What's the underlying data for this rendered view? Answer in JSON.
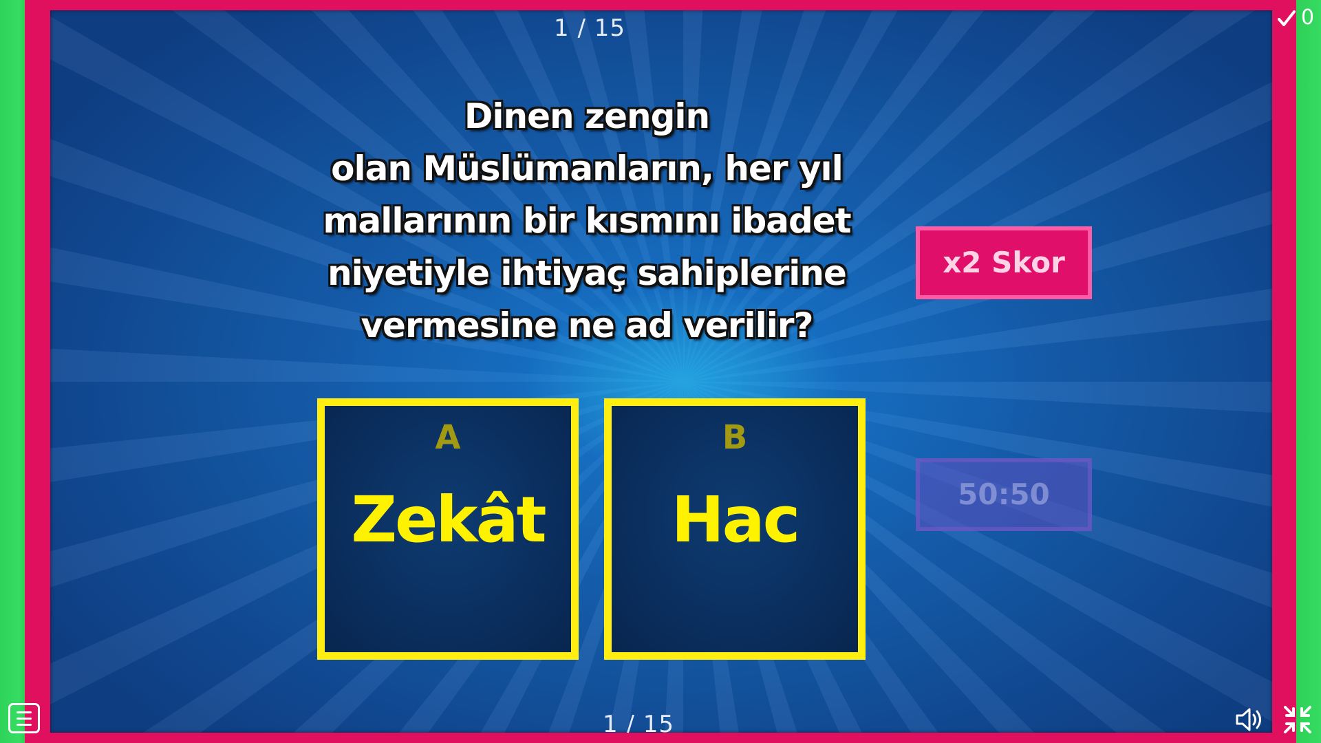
{
  "progress": {
    "top": "1 / 15",
    "bottom": "1 / 15"
  },
  "score": {
    "icon": "check-icon",
    "count": "0"
  },
  "question": {
    "lines": [
      "Dinen zengin",
      "olan Müslümanların, her yıl",
      "mallarının bir kısmını ibadet",
      "niyetiyle ihtiyaç sahiplerine",
      "vermesine ne ad verilir?"
    ]
  },
  "answers": [
    {
      "letter": "A",
      "text": "Zekât"
    },
    {
      "letter": "B",
      "text": "Hac"
    }
  ],
  "powerups": {
    "double_score": "x2 Skor",
    "fifty_fifty": "50:50"
  },
  "controls": {
    "menu_icon": "menu-icon",
    "sound_icon": "speaker-icon",
    "fullscreen_icon": "exit-fullscreen-icon"
  },
  "colors": {
    "frame": "#e0105f",
    "answer_border": "#ffee10",
    "answer_text": "#fff200",
    "powerup_active": "#e0106a"
  }
}
